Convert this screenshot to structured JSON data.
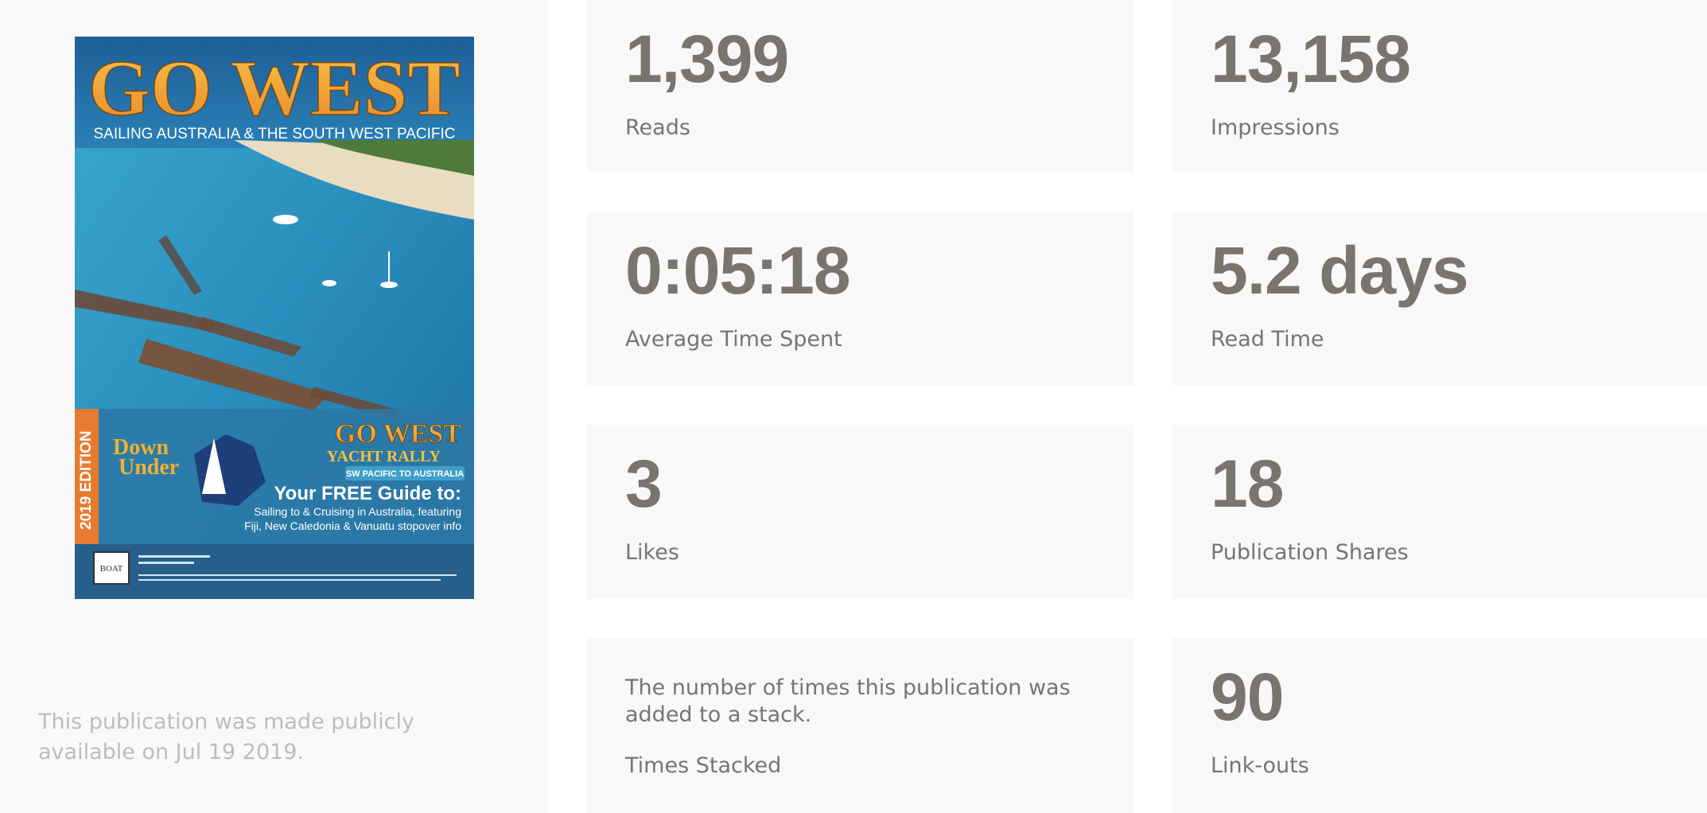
{
  "cover": {
    "title": "GO WEST",
    "subtitle": "SAILING AUSTRALIA & THE SOUTH WEST PACIFIC",
    "edition": "2019 EDITION",
    "rally_title": "GO WEST",
    "rally_sub": "YACHT RALLY",
    "rally_route": "SW PACIFIC TO AUSTRALIA",
    "logo_text_1": "Down",
    "logo_text_2": "Under",
    "guide_heading": "Your FREE Guide to:",
    "guide_line1": "Sailing to & Cruising in Australia, featuring",
    "guide_line2": "Fiji, New Caledonia & Vanuatu stopover info",
    "badge": "BOAT",
    "colors": {
      "title_gold": "#f0a830",
      "sea": "#2d86b8",
      "edition_orange": "#e87a30"
    }
  },
  "publication_note": "This publication was made publicly available on Jul 19 2019.",
  "stats": {
    "reads": {
      "value": "1,399",
      "label": "Reads"
    },
    "impressions": {
      "value": "13,158",
      "label": "Impressions"
    },
    "avg_time": {
      "value": "0:05:18",
      "label": "Average Time Spent"
    },
    "read_time": {
      "value": "5.2 days",
      "label": "Read Time"
    },
    "likes": {
      "value": "3",
      "label": "Likes"
    },
    "shares": {
      "value": "18",
      "label": "Publication Shares"
    },
    "stacked": {
      "description": "The number of times this publication was added to a stack.",
      "label": "Times Stacked"
    },
    "linkouts": {
      "value": "90",
      "label": "Link-outs"
    }
  }
}
